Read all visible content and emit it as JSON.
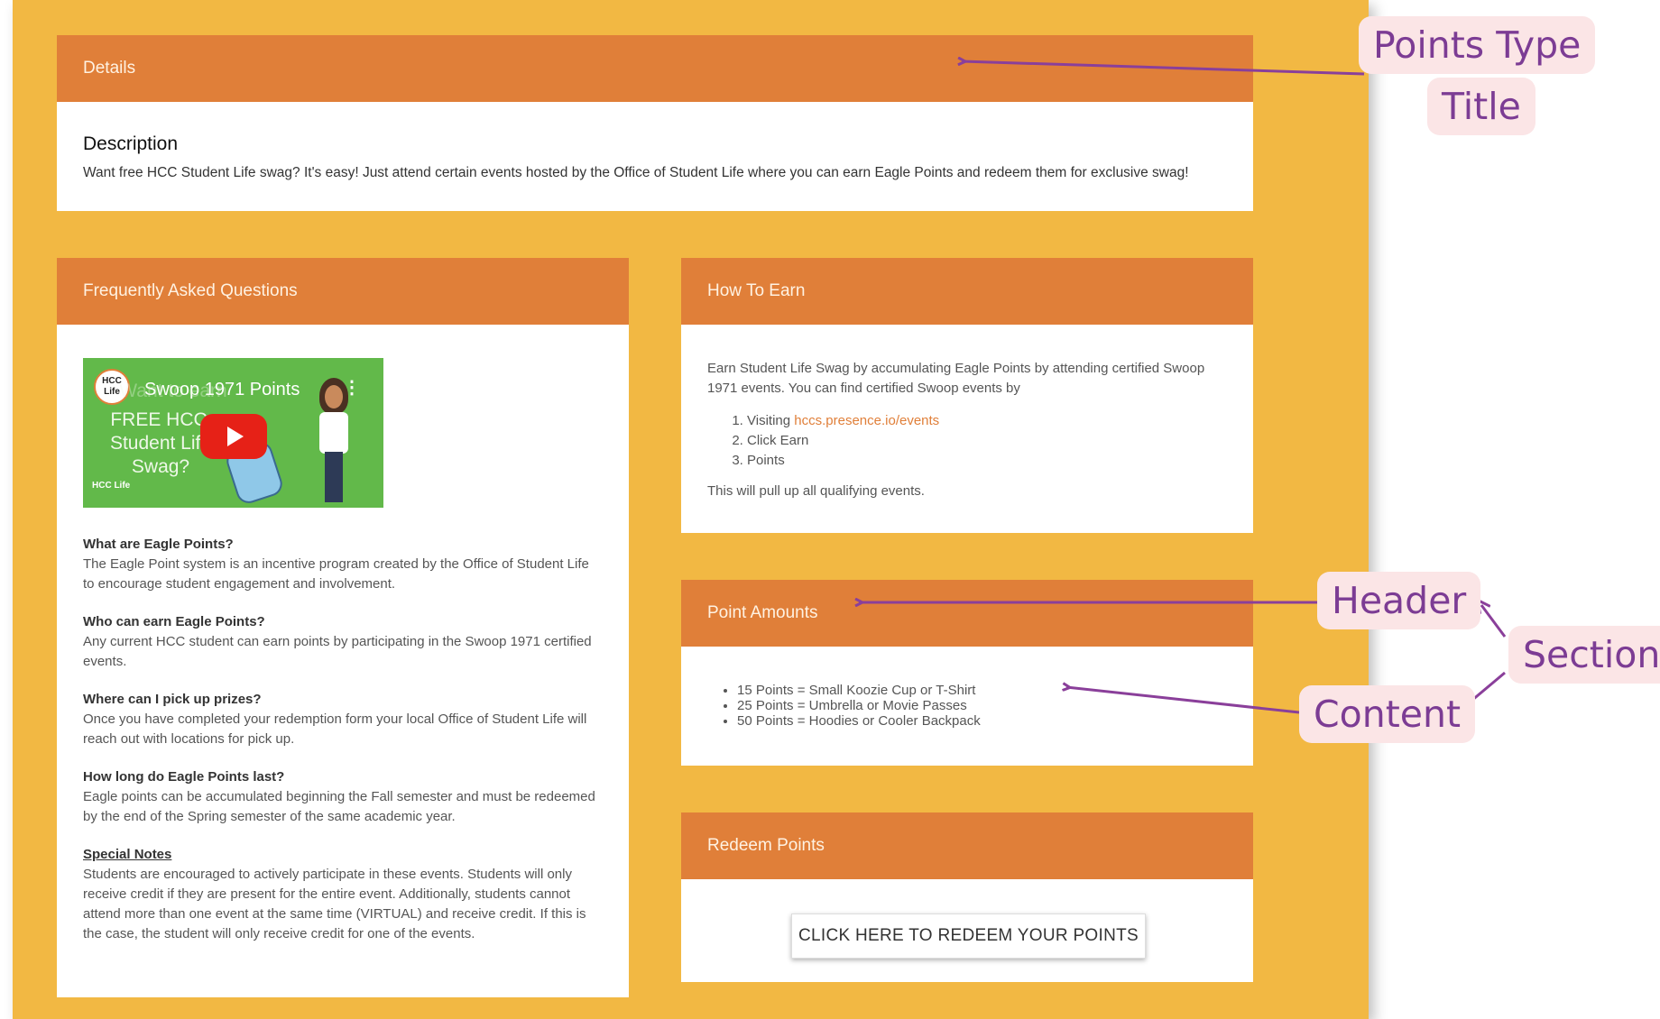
{
  "details": {
    "header": "Details",
    "description_title": "Description",
    "description_text": "Want free HCC Student Life swag? It's easy! Just attend certain events hosted by the Office of Student Life where you can earn Eagle Points and redeem them for exclusive swag!"
  },
  "faq": {
    "header": "Frequently Asked Questions",
    "video": {
      "channel_logo": "HCC Life",
      "title": "Swoop 1971 Points",
      "overlay_lines": [
        "Want to earn",
        "FREE HCC",
        "Student Life",
        "Swag?"
      ],
      "corner_logo": "HCC Life",
      "icon": "play-icon"
    },
    "items": [
      {
        "q": "What are Eagle Points?",
        "a": "The Eagle Point system is an incentive program created by the Office of Student Life to encourage student engagement and involvement."
      },
      {
        "q": "Who can earn Eagle Points?",
        "a": "Any current HCC student can earn points by participating in the Swoop 1971 certified events."
      },
      {
        "q": "Where can I pick up prizes?",
        "a": "Once you have completed your redemption form your local Office of Student Life will reach out with locations for pick up."
      },
      {
        "q": "How long do Eagle Points last?",
        "a": "Eagle points can be accumulated beginning the Fall semester and must be redeemed by the end of the Spring semester of the same academic year."
      },
      {
        "q": "Special Notes",
        "a": "Students are encouraged to actively participate in these events. Students will only receive credit if they are present for the entire event. Additionally, students cannot attend more than one event at the same time (VIRTUAL) and receive credit. If this is the case, the student will only receive credit for one of the events."
      }
    ]
  },
  "how_to_earn": {
    "header": "How To Earn",
    "intro": "Earn Student Life Swag by accumulating Eagle Points by attending certified Swoop 1971 events. You can find certified Swoop events by",
    "step1_prefix": "Visiting ",
    "step1_link": "hccs.presence.io/events",
    "step2": "Click Earn",
    "step3": "Points",
    "outro": "This will pull up all qualifying events."
  },
  "point_amounts": {
    "header": "Point Amounts",
    "items": [
      "15 Points = Small Koozie Cup or T-Shirt",
      "25 Points = Umbrella or Movie Passes",
      "50 Points = Hoodies or Cooler Backpack"
    ]
  },
  "redeem": {
    "header": "Redeem Points",
    "button": "CLICK HERE TO REDEEM YOUR POINTS"
  },
  "callouts": {
    "points_type": "Points Type",
    "title": "Title",
    "header": "Header",
    "section": "Section",
    "content": "Content",
    "color": "#7c3c94"
  }
}
